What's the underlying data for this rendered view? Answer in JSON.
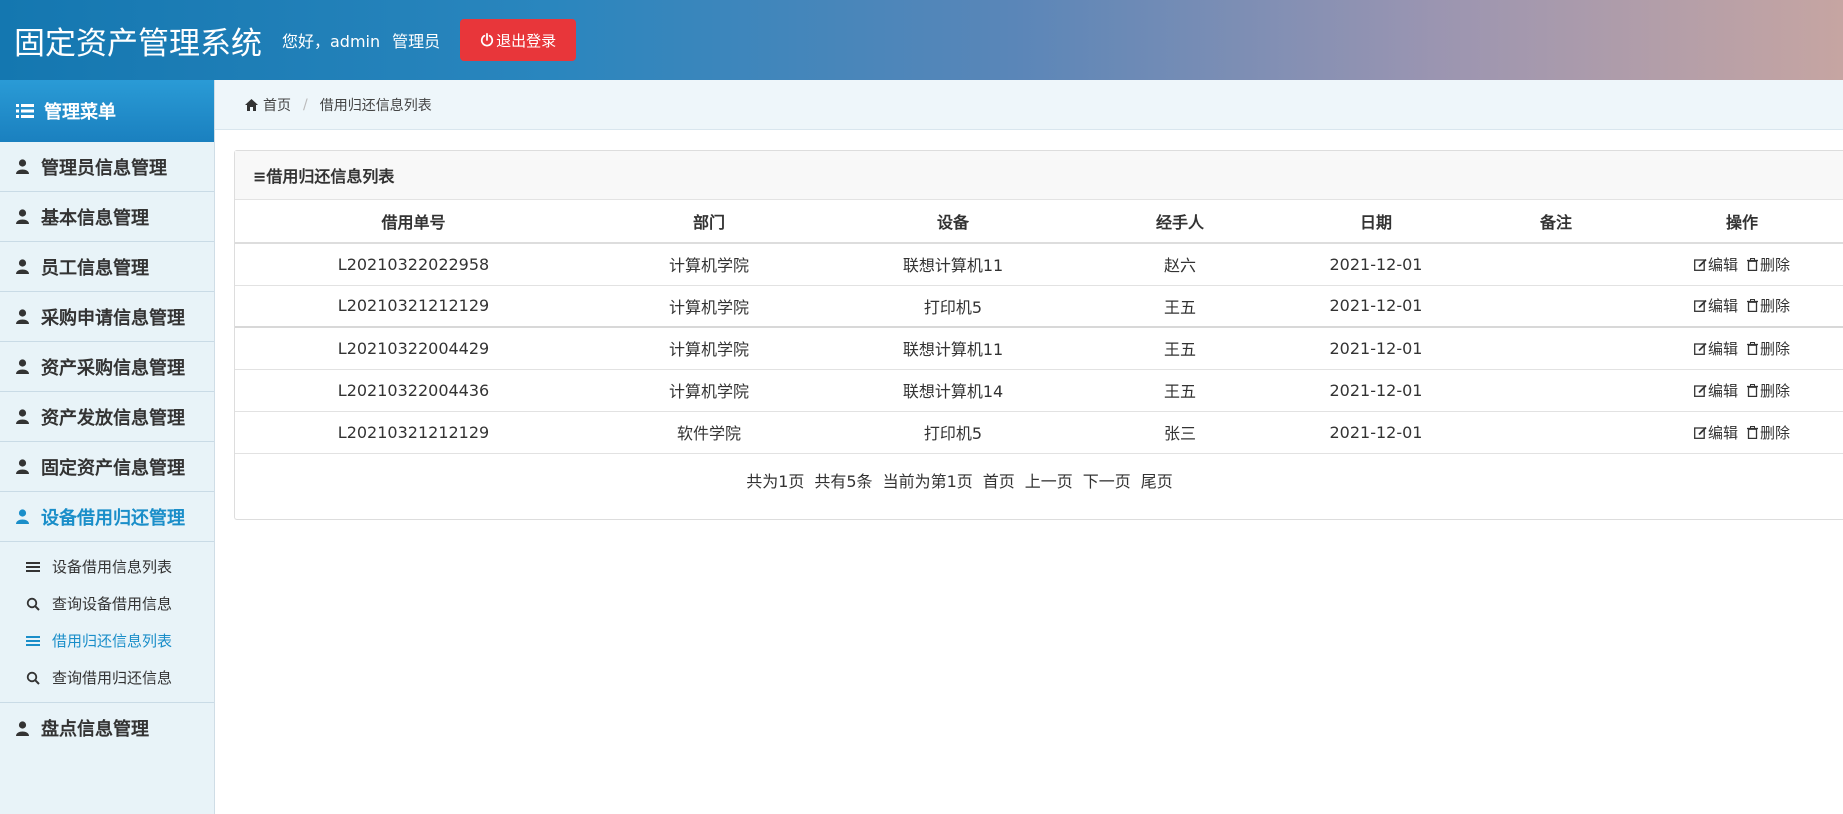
{
  "header": {
    "title": "固定资产管理系统",
    "greeting": "您好，admin",
    "role": "管理员",
    "logout_label": "退出登录"
  },
  "sidebar": {
    "heading": "管理菜单",
    "items": [
      {
        "label": "管理员信息管理"
      },
      {
        "label": "基本信息管理"
      },
      {
        "label": "员工信息管理"
      },
      {
        "label": "采购申请信息管理"
      },
      {
        "label": "资产采购信息管理"
      },
      {
        "label": "资产发放信息管理"
      },
      {
        "label": "固定资产信息管理"
      },
      {
        "label": "设备借用归还管理"
      },
      {
        "label": "盘点信息管理"
      }
    ],
    "sub_items": [
      {
        "label": "设备借用信息列表",
        "icon": "list-icon"
      },
      {
        "label": "查询设备借用信息",
        "icon": "search-icon"
      },
      {
        "label": "借用归还信息列表",
        "icon": "list-icon"
      },
      {
        "label": "查询借用归还信息",
        "icon": "search-icon"
      }
    ]
  },
  "breadcrumb": {
    "home": "首页",
    "current": "借用归还信息列表"
  },
  "panel": {
    "title": "≡借用归还信息列表"
  },
  "table": {
    "headers": [
      "借用单号",
      "部门",
      "设备",
      "经手人",
      "日期",
      "备注",
      "操作"
    ],
    "rows": [
      [
        "L20210322022958",
        "计算机学院",
        "联想计算机11",
        "赵六",
        "2021-12-01",
        ""
      ],
      [
        "L20210321212129",
        "计算机学院",
        "打印机5",
        "王五",
        "2021-12-01",
        ""
      ],
      [
        "L20210322004429",
        "计算机学院",
        "联想计算机11",
        "王五",
        "2021-12-01",
        ""
      ],
      [
        "L20210322004436",
        "计算机学院",
        "联想计算机14",
        "王五",
        "2021-12-01",
        ""
      ],
      [
        "L20210321212129",
        "软件学院",
        "打印机5",
        "张三",
        "2021-12-01",
        ""
      ]
    ],
    "edit_label": "编辑",
    "delete_label": "删除"
  },
  "pager": {
    "total_pages": "共为1页",
    "total_records": "共有5条",
    "current_page": "当前为第1页",
    "first": "首页",
    "prev": "上一页",
    "next": "下一页",
    "last": "尾页"
  },
  "colors": {
    "accent": "#1a8ec9",
    "logout": "#e8363a"
  }
}
